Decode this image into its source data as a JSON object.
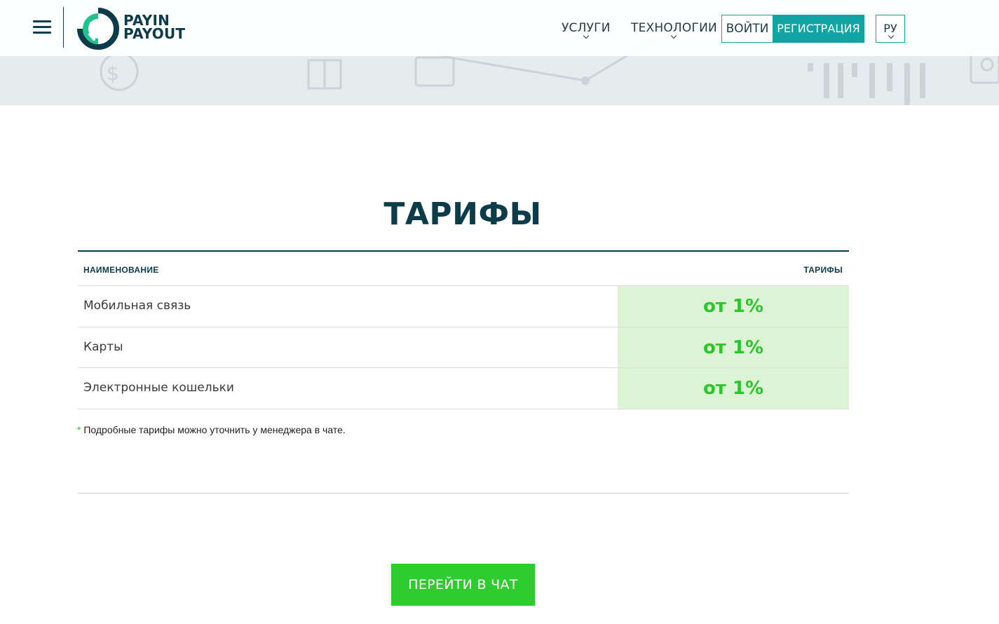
{
  "header": {
    "logo": {
      "line1": "PAYIN",
      "line2": "PAYOUT"
    },
    "nav": [
      {
        "label": "УСЛУГИ"
      },
      {
        "label": "ТЕХНОЛОГИИ"
      }
    ],
    "login_label": "ВОЙТИ",
    "register_label": "РЕГИСТРАЦИЯ",
    "language": "РУ"
  },
  "main": {
    "title": "ТАРИФЫ",
    "table": {
      "columns": [
        "НАИМЕНОВАНИЕ",
        "ТАРИФЫ"
      ],
      "rows": [
        {
          "name": "Мобильная связь",
          "rate": "от 1%"
        },
        {
          "name": "Карты",
          "rate": "от 1%"
        },
        {
          "name": "Электронные кошельки",
          "rate": "от 1%"
        }
      ]
    },
    "note_star": "*",
    "note": "Подробные тарифы можно уточнить у менеджера в чате.",
    "chat_button": "ПЕРЕЙТИ В ЧАТ"
  },
  "colors": {
    "brand_dark": "#0c3b4a",
    "teal": "#12a3a3",
    "green": "#2cc52c",
    "rate_bg": "#ddf3d6"
  }
}
